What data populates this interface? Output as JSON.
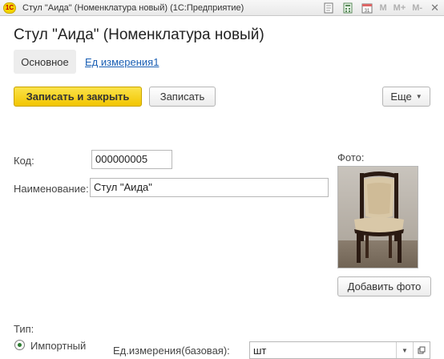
{
  "window": {
    "title": "Стул \"Аида\" (Номенклатура новый)  (1С:Предприятие)",
    "logo": "1С",
    "toolbar_m": [
      "M",
      "M+",
      "M-"
    ],
    "calendar_day": "31"
  },
  "form": {
    "title": "Стул \"Аида\" (Номенклатура новый)",
    "tabs": {
      "basic": "Основное",
      "units": "Ед измерения1"
    },
    "buttons": {
      "save_close": "Записать и закрыть",
      "save": "Записать",
      "more": "Еще",
      "add_photo": "Добавить фото"
    },
    "fields": {
      "code_label": "Код:",
      "code_value": "000000005",
      "name_label": "Наименование:",
      "name_value": "Стул \"Аида\"",
      "photo_label": "Фото:",
      "type_label": "Тип:",
      "type_option": "Импортный",
      "unit_label": "Ед.измерения(базовая):",
      "unit_value": "шт"
    }
  },
  "colors": {
    "primary_button": "#f2c500",
    "link": "#1a5fb4",
    "radio_selected": "#2e7d32"
  },
  "icons": [
    "app-logo-icon",
    "document-icon",
    "calculator-icon",
    "calendar-icon",
    "close-icon",
    "dropdown-arrow-icon",
    "open-form-icon"
  ]
}
